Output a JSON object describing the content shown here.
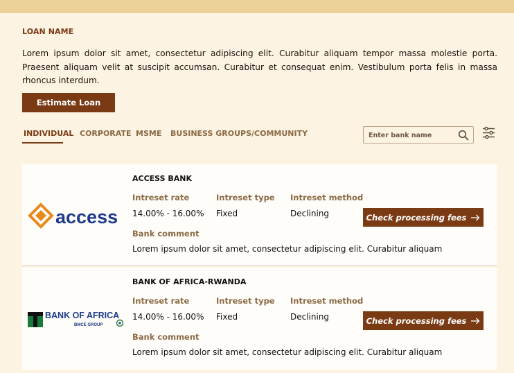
{
  "header": {
    "section_title": "LOAN NAME"
  },
  "description": "Lorem ipsum dolor sit amet, consectetur adipiscing elit. Curabitur aliquam tempor massa molestie porta. Praesent aliquam velit at suscipit accumsan. Curabitur et consequat enim. Vestibulum porta felis in massa rhoncus interdum.",
  "estimate_button": "Estimate Loan",
  "tabs": [
    {
      "label": "INDIVIDUAL",
      "active": true
    },
    {
      "label": "CORPORATE",
      "active": false
    },
    {
      "label": "MSME",
      "active": false
    },
    {
      "label": "BUSINESS GROUPS/COMMUNITY",
      "active": false
    }
  ],
  "search": {
    "placeholder": "Enter bank name",
    "icon": "search-icon"
  },
  "filter": {
    "icon": "sliders-icon"
  },
  "columns": {
    "rate": "Intreset rate",
    "type": "Intreset type",
    "method": "Intreset method",
    "comment": "Bank comment"
  },
  "banks": [
    {
      "name": "ACCESS BANK",
      "logo_text": "access",
      "rate": "14.00% - 16.00%",
      "type": "Fixed",
      "method": "Declining",
      "comment": "Lorem ipsum dolor sit amet, consectetur adipiscing elit. Curabitur aliquam",
      "button": "Check processing fees"
    },
    {
      "name": "BANK OF AFRICA-RWANDA",
      "logo_text": "BANK OF AFRICA",
      "logo_subtext": "BMCE GROUP",
      "rate": "14.00% - 16.00%",
      "type": "Fixed",
      "method": "Declining",
      "comment": "Lorem ipsum dolor sit amet, consectetur adipiscing elit. Curabitur aliquam",
      "button": "Check processing fees"
    }
  ],
  "colors": {
    "accent": "#7a3a14",
    "background": "#fdf3e3",
    "topbar": "#ecd298",
    "label": "#8a6a45",
    "access_blue": "#1e3a8a",
    "access_orange": "#e8891d"
  }
}
